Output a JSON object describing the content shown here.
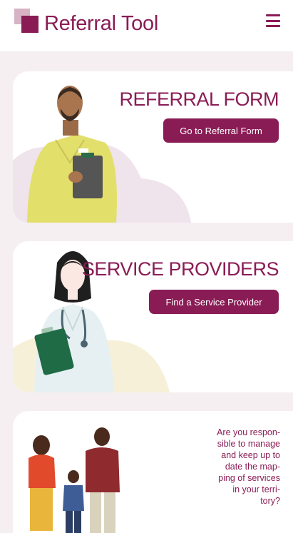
{
  "header": {
    "title": "Referral Tool",
    "menu_icon": "hamburger-menu-icon"
  },
  "cards": [
    {
      "title": "REFERRAL FORM",
      "button_label": "Go to Referral Form"
    },
    {
      "title": "SERVICE PROVIDERS",
      "button_label": "Find a Service Provider"
    },
    {
      "text_lines": [
        "Are you respon-",
        "sible to manage",
        "and keep up to",
        "date the map-",
        "ping of services",
        "in your terri-",
        "tory?"
      ]
    }
  ],
  "colors": {
    "brand": "#8a1c55",
    "background": "#f5eff1"
  }
}
